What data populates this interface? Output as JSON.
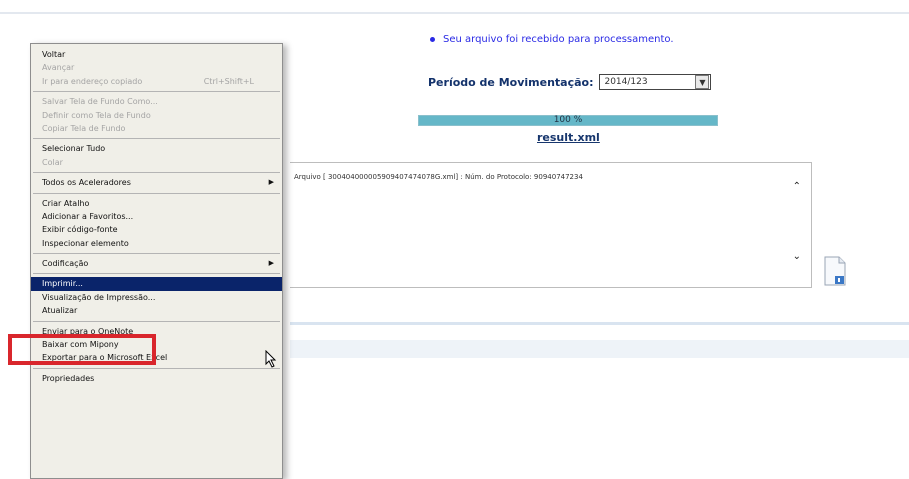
{
  "page": {
    "status_message": "Seu arquivo foi recebido para processamento.",
    "period_label": "Período de Movimentação:",
    "period_value": "2014/123",
    "progress_label": "100 %",
    "progress": 1.0,
    "result_link": "result.xml",
    "log_line": "Arquivo [ 300404000005909407474078G.xml] : Núm. do Protocolo: 90940747234"
  },
  "context_menu": {
    "items": [
      {
        "label": "Voltar",
        "disabled": false
      },
      {
        "label": "Avançar",
        "disabled": true
      },
      {
        "label": "Ir para endereço copiado",
        "shortcut": "Ctrl+Shift+L",
        "disabled": true
      },
      {
        "separator": true
      },
      {
        "label": "Salvar Tela de Fundo Como...",
        "disabled": true
      },
      {
        "label": "Definir como Tela de Fundo",
        "disabled": true
      },
      {
        "label": "Copiar Tela de Fundo",
        "disabled": true
      },
      {
        "separator": true
      },
      {
        "label": "Selecionar Tudo",
        "disabled": false
      },
      {
        "label": "Colar",
        "disabled": true
      },
      {
        "separator": true
      },
      {
        "label": "Todos os Aceleradores",
        "submenu": true,
        "disabled": false
      },
      {
        "separator": true
      },
      {
        "label": "Criar Atalho",
        "disabled": false
      },
      {
        "label": "Adicionar a Favoritos...",
        "disabled": false
      },
      {
        "label": "Exibir código-fonte",
        "disabled": false
      },
      {
        "label": "Inspecionar elemento",
        "disabled": false
      },
      {
        "separator": true
      },
      {
        "label": "Codificação",
        "submenu": true,
        "disabled": false
      },
      {
        "separator": true
      },
      {
        "label": "Imprimir...",
        "hover": true,
        "disabled": false
      },
      {
        "label": "Visualização de Impressão...",
        "disabled": false
      },
      {
        "label": "Atualizar",
        "disabled": false
      },
      {
        "separator": true
      },
      {
        "label": "Enviar para o OneNote",
        "disabled": false
      },
      {
        "label": "Baixar com Mipony",
        "disabled": false
      },
      {
        "label": "Exportar para o Microsoft Excel",
        "disabled": false
      },
      {
        "separator": true
      },
      {
        "label": "Propriedades",
        "disabled": false
      }
    ]
  },
  "colors": {
    "link": "#2a2ae5",
    "menu_highlight": "#0a246a",
    "annotation_red": "#d9262c",
    "progress_fill": "#65b7c8"
  },
  "icons": {
    "document": "document-icon",
    "cursor": "mouse-cursor-icon",
    "submenu": "submenu-arrow-icon",
    "scroll_up": "chevron-up-icon",
    "scroll_down": "chevron-down-icon"
  }
}
